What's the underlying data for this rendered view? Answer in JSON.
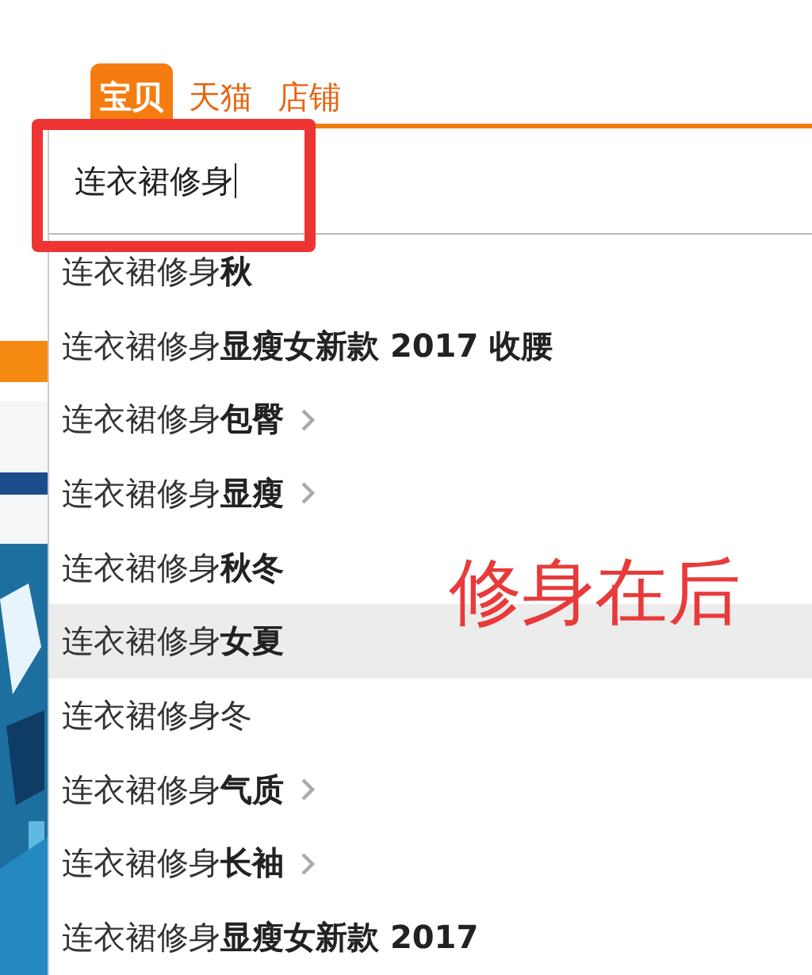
{
  "tabs": [
    {
      "label": "宝贝",
      "selected": true
    },
    {
      "label": "天猫",
      "selected": false
    },
    {
      "label": "店铺",
      "selected": false
    }
  ],
  "search": {
    "value": "连衣裙修身"
  },
  "annotation": {
    "note": "修身在后"
  },
  "suggestions": [
    {
      "text": "连衣裙修身**秋**",
      "selected": false,
      "submenu": false
    },
    {
      "text": "连衣裙修身**显瘦女新款 2017 收腰**",
      "selected": false,
      "submenu": false
    },
    {
      "text": "连衣裙修身**包臀**",
      "selected": false,
      "submenu": true
    },
    {
      "text": "连衣裙修身**显瘦**",
      "selected": false,
      "submenu": true
    },
    {
      "text": "连衣裙修身**秋冬**",
      "selected": false,
      "submenu": false
    },
    {
      "text": "连衣裙修身**女夏**",
      "selected": true,
      "submenu": false
    },
    {
      "text": "连衣裙修身冬",
      "selected": false,
      "submenu": false
    },
    {
      "text": "连衣裙修身**气质**",
      "selected": false,
      "submenu": true
    },
    {
      "text": "连衣裙修身**长袖**",
      "selected": false,
      "submenu": true
    },
    {
      "text": "连衣裙修身**显瘦女新款 2017**",
      "selected": false,
      "submenu": false
    }
  ]
}
